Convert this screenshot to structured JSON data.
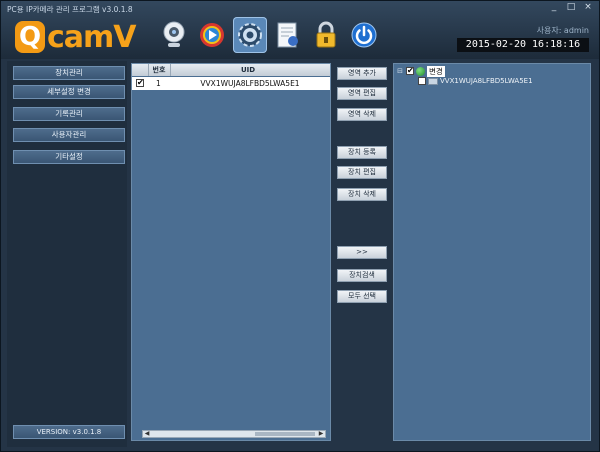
{
  "window": {
    "title": "PC용 IP카메라 관리 프로그램 v3.0.1.8",
    "controls": [
      "_",
      "□",
      "×"
    ]
  },
  "logo": {
    "q": "Q",
    "rest": "camV"
  },
  "toolbar": {
    "icons": [
      "webcam-icon",
      "player-icon",
      "gear-icon",
      "document-icon",
      "lock-icon",
      "power-icon"
    ],
    "active_index": 2
  },
  "header": {
    "user_label": "사용자: admin",
    "datetime": "2015-02-20  16:18:16"
  },
  "sidebar": {
    "items": [
      {
        "label": "장치관리"
      },
      {
        "label": "세부설정 변경"
      },
      {
        "label": "기록관리"
      },
      {
        "label": "사용자관리"
      },
      {
        "label": "기타설정"
      }
    ],
    "version": "VERSION: v3.0.1.8"
  },
  "device_list": {
    "columns": {
      "num": "번호",
      "uid": "UID"
    },
    "rows": [
      {
        "checked": true,
        "num": "1",
        "uid": "VVX1WUJA8LFBD5LWA5E1"
      }
    ]
  },
  "actions": {
    "add_area": "영역 추가",
    "edit_area": "영역 편집",
    "delete_area": "영역 삭제",
    "register_device": "장치 등록",
    "edit_device": "장치 편집",
    "delete_device": "장치 삭제",
    "move": ">>",
    "search_device": "장치검색",
    "select_all": "모두 선택"
  },
  "tree": {
    "group_label": "변경",
    "group_checked": true,
    "device_uid": "VVX1WUJA8LFBD5LWA5E1",
    "device_checked": false
  },
  "colors": {
    "accent_orange": "#f39a14",
    "panel_blue": "#4b6e92",
    "active_tool": "#5a88b8"
  }
}
